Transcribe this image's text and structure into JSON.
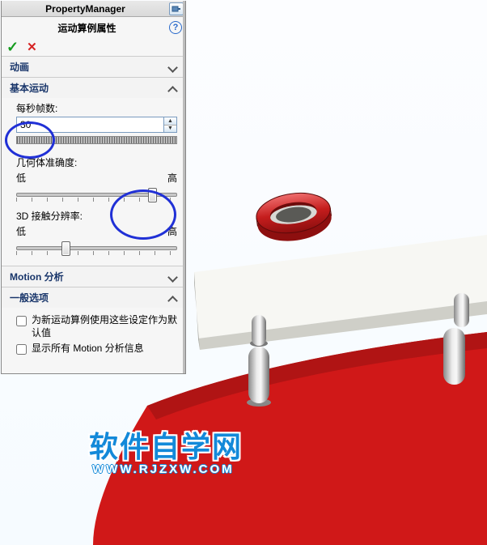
{
  "panel": {
    "header": "PropertyManager",
    "subtitle": "运动算例属性",
    "ok": "✓",
    "cancel": "✕"
  },
  "sections": {
    "animation": "动画",
    "basic_motion": {
      "title": "基本运动",
      "fps_label": "每秒帧数:",
      "fps_value": "30",
      "geom_label": "几何体准确度:",
      "low": "低",
      "high": "高",
      "contact_label": "3D 接触分辨率:"
    },
    "motion_analysis": "Motion 分析",
    "general_options": {
      "title": "一般选项",
      "opt1": "为新运动算例使用这些设定作为默认值",
      "opt2": "显示所有 Motion 分析信息"
    }
  },
  "watermark": {
    "line1": "软件自学网",
    "line2": "WWW.RJZXW.COM"
  }
}
